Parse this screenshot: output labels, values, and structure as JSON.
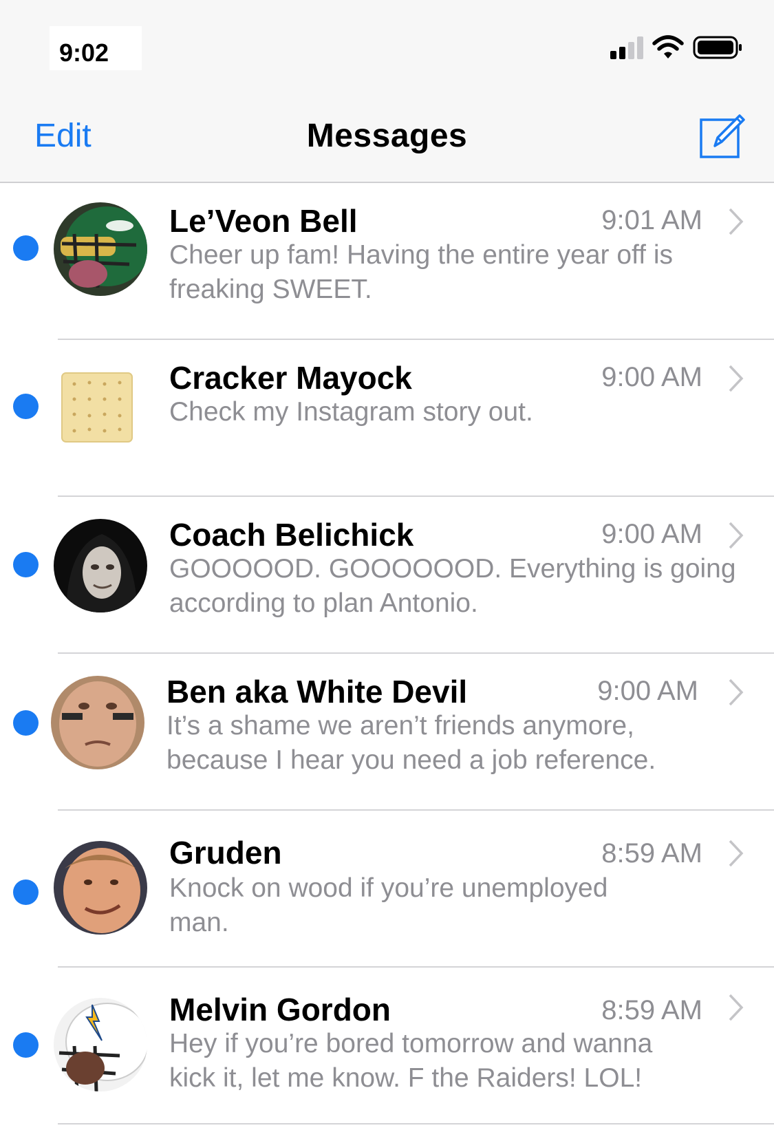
{
  "status_bar": {
    "time": "9:02",
    "icons": [
      "cellular-signal-icon",
      "wifi-icon",
      "battery-icon"
    ]
  },
  "nav": {
    "edit_label": "Edit",
    "title": "Messages",
    "compose_icon": "compose-icon"
  },
  "colors": {
    "accent": "#1a7bf2",
    "secondary_text": "#8e8e93",
    "bar_background": "#f7f7f7"
  },
  "conversations": [
    {
      "name": "Le’Veon Bell",
      "time": "9:01 AM",
      "preview": "Cheer up fam!  Having the entire year off is freaking SWEET.",
      "unread": true,
      "avatar": "football-helmet-avatar"
    },
    {
      "name": "Cracker Mayock",
      "time": "9:00 AM",
      "preview": "Check my Instagram story out.",
      "unread": true,
      "avatar": "cracker-avatar"
    },
    {
      "name": "Coach Belichick",
      "time": "9:00 AM",
      "preview": "GOOOOOD.  GOOOOOOD.  Everything is going according to plan Antonio.",
      "unread": true,
      "avatar": "hooded-figure-avatar"
    },
    {
      "name": "Ben aka White Devil",
      "time": "9:00 AM",
      "preview": "It’s a shame we aren’t friends anymore, because I hear you need a job reference.",
      "unread": true,
      "avatar": "face-portrait-avatar"
    },
    {
      "name": "Gruden",
      "time": "8:59 AM",
      "preview": "Knock on wood if you’re unemployed man.",
      "unread": true,
      "avatar": "face-portrait-avatar"
    },
    {
      "name": "Melvin Gordon",
      "time": "8:59 AM",
      "preview": "Hey if you’re bored tomorrow and wanna kick it, let me know. F the Raiders! LOL!",
      "unread": true,
      "avatar": "chargers-helmet-avatar"
    }
  ]
}
